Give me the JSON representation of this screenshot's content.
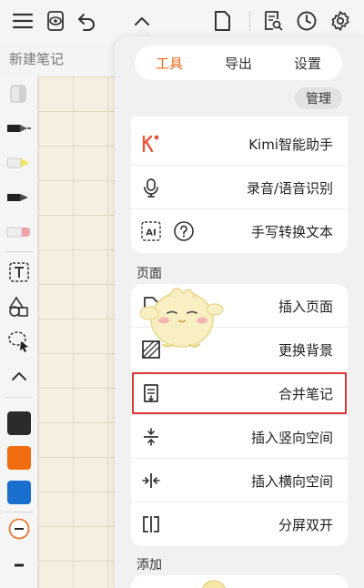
{
  "note": {
    "title": "新建笔记"
  },
  "tabs": [
    {
      "label": "工具",
      "active": true
    },
    {
      "label": "导出",
      "active": false
    },
    {
      "label": "设置",
      "active": false
    }
  ],
  "manage_label": "管理",
  "tools_items": [
    {
      "label": "Kimi智能助手",
      "icon": "kimi-logo-icon"
    },
    {
      "label": "录音/语音识别",
      "icon": "microphone-icon"
    },
    {
      "label": "手写转换文本",
      "icon": "ai-help-icon"
    }
  ],
  "page_section": {
    "title": "页面"
  },
  "page_items": [
    {
      "label": "插入页面",
      "icon": "insert-page-icon"
    },
    {
      "label": "更换背景",
      "icon": "change-background-icon"
    },
    {
      "label": "合并笔记",
      "icon": "merge-notes-icon",
      "highlighted": true
    },
    {
      "label": "插入竖向空间",
      "icon": "vertical-space-icon"
    },
    {
      "label": "插入横向空间",
      "icon": "horizontal-space-icon"
    },
    {
      "label": "分屏双开",
      "icon": "split-screen-icon"
    }
  ],
  "add_section": {
    "title": "添加"
  },
  "toolbar_icons": [
    "menu-icon",
    "eye-icon",
    "undo-icon",
    "chevron-up-icon",
    "page-icon",
    "search-document-icon",
    "clock-icon",
    "gear-icon"
  ],
  "colors": {
    "accent": "#ef6a1a",
    "swatch_black": "#2b2b2b",
    "swatch_orange": "#f26d10",
    "swatch_blue": "#1b6fcf",
    "highlight_border": "#d33333"
  }
}
